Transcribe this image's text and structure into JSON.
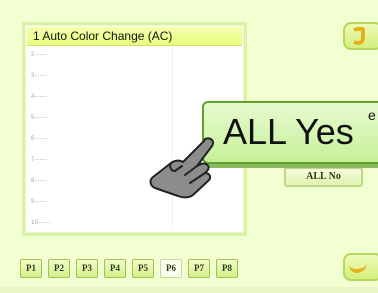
{
  "list": {
    "header": "1 Auto Color Change (AC)",
    "items": [
      "2-----",
      "3-----",
      "4-----",
      "5-----",
      "6-----",
      "7-----",
      "8-----",
      "9-----",
      "10-----"
    ]
  },
  "popup": {
    "label": "ALL Yes",
    "superscript": "e"
  },
  "all_no_label": "ALL No",
  "tabs": [
    "P1",
    "P2",
    "P3",
    "P4",
    "P5",
    "P6",
    "P7",
    "P8"
  ],
  "active_tab": "P6",
  "colors": {
    "background": "#f2ffd0",
    "header": "#e9ff7e",
    "popup": "#c7f09a",
    "accent": "#e5b01b"
  },
  "icons": [
    "undo-icon",
    "return-icon",
    "hand-pointer-icon"
  ]
}
